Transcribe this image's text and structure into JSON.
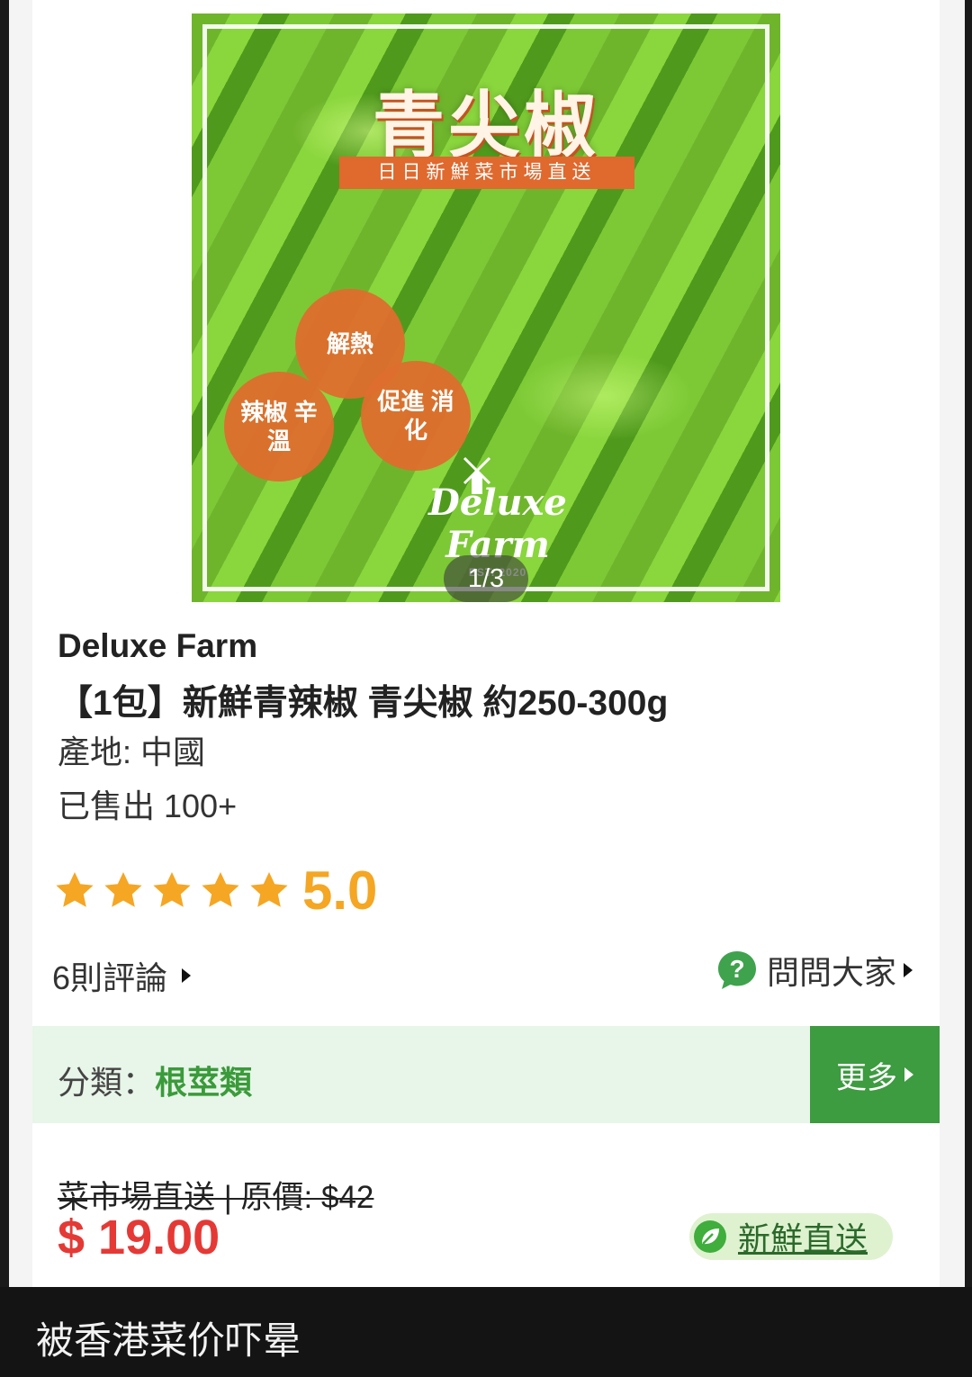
{
  "product_image": {
    "title": "青尖椒",
    "banner": "日日新鮮菜市場直送",
    "badges": [
      "解熱",
      "辣椒 辛溫",
      "促進 消化"
    ],
    "logo": "Deluxe Farm",
    "logo_est": "EST. 2020",
    "counter": "1/3"
  },
  "product": {
    "brand": "Deluxe Farm",
    "title": "【1包】新鮮青辣椒 青尖椒 約250-300g",
    "origin": "產地: 中國",
    "sold": "已售出 100+",
    "rating": "5.0",
    "rating_stars": 5
  },
  "links": {
    "reviews": "6則評論",
    "ask": "問問大家"
  },
  "category": {
    "label": "分類：",
    "value": "根莖類",
    "more": "更多"
  },
  "price": {
    "original": "菜市場直送 | 原價: $42",
    "sale": "$ 19.00",
    "badge": "新鮮直送"
  },
  "caption": "被香港菜价吓晕",
  "colors": {
    "accent_green": "#3d9b40",
    "price_red": "#e53935",
    "star_gold": "#f5a623",
    "category_bg": "#e8f5e9"
  },
  "icons": [
    "windmill-icon",
    "star-icon",
    "question-bubble-icon",
    "leaf-icon"
  ]
}
